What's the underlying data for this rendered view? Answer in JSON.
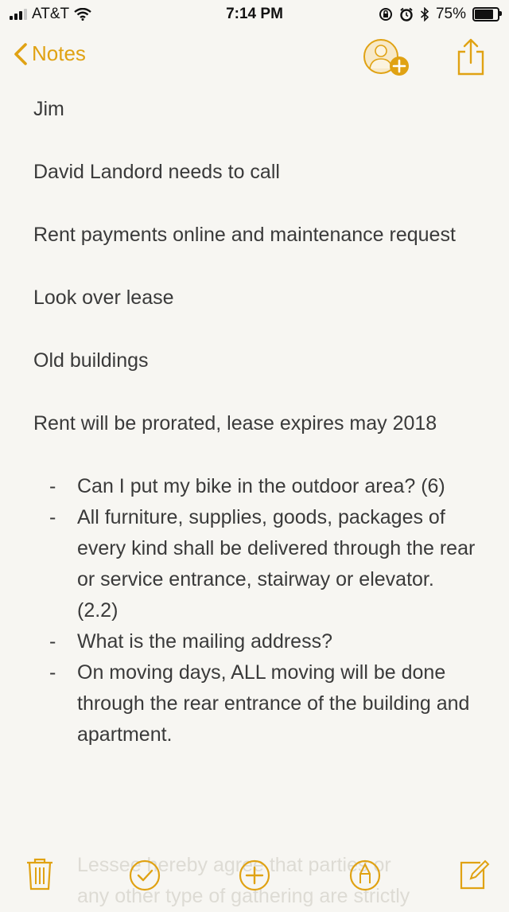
{
  "status_bar": {
    "carrier": "AT&T",
    "time": "7:14 PM",
    "battery_percent": "75%",
    "battery_level": 0.75
  },
  "nav": {
    "back_label": "Notes",
    "add_person_icon": "add-person-icon",
    "share_icon": "share-icon",
    "accent_color": "#e0a213"
  },
  "note": {
    "paragraphs": [
      "Jim",
      "David Landord needs to call",
      "Rent payments online and maintenance request",
      "Look over lease",
      "Old buildings",
      "Rent will be prorated, lease expires may 2018"
    ],
    "bullet_marker": "-",
    "bullets": [
      "Can I put my bike in the outdoor area? (6)",
      "All furniture, supplies, goods, packages of every kind shall be delivered through the rear or service entrance, stairway or elevator. (2.2)",
      "What is the mailing address?",
      "On moving days, ALL moving will be done through the rear entrance of the building and apartment."
    ],
    "overflow_text": [
      "Lessee hereby agree that parties or",
      "any other type of gathering are strictly"
    ]
  },
  "toolbar": {
    "items": [
      "trash-icon",
      "checklist-icon",
      "add-icon",
      "markup-icon",
      "compose-icon"
    ]
  }
}
